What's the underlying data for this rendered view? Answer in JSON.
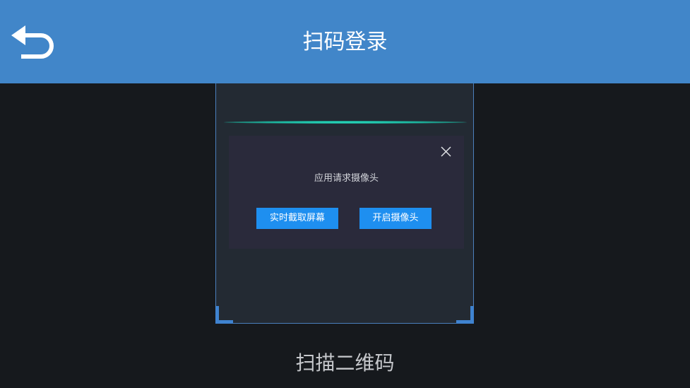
{
  "header": {
    "title": "扫码登录",
    "back_icon": "back-arrow-icon"
  },
  "scanner": {
    "caption": "扫描二维码"
  },
  "dialog": {
    "message": "应用请求摄像头",
    "capture_button": "实时截取屏幕",
    "camera_button": "开启摄像头",
    "close_icon": "close-icon"
  },
  "colors": {
    "header_bg": "#4186c9",
    "page_bg": "#16191d",
    "frame_bg": "#232a33",
    "dialog_bg": "#2a2a3b",
    "button_bg": "#1e8ff0",
    "scan_line": "#2ce3c4"
  }
}
